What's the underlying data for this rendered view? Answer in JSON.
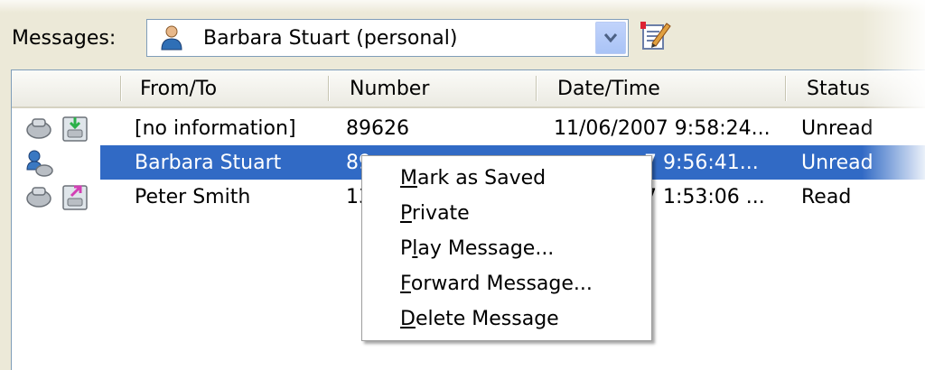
{
  "toolbar": {
    "label": "Messages:",
    "selected_mailbox": "Barbara Stuart (personal)",
    "icons": [
      "person-icon",
      "dropdown-arrow-icon",
      "edit-properties-icon"
    ]
  },
  "table": {
    "columns": [
      "From/To",
      "Number",
      "Date/Time",
      "Status"
    ],
    "rows": [
      {
        "icons": [
          "phone-icon",
          "incoming-message-icon"
        ],
        "from": "[no information]",
        "number": "89626",
        "datetime": "11/06/2007 9:58:24...",
        "status": "Unread",
        "selected": false
      },
      {
        "icons": [
          "user-phone-icon"
        ],
        "from": "Barbara Stuart",
        "number": "89",
        "datetime": "7 9:56:41...",
        "status": "Unread",
        "selected": true
      },
      {
        "icons": [
          "phone-icon",
          "outgoing-message-icon"
        ],
        "from": "Peter Smith",
        "number": "13",
        "datetime": "7 1:53:06 ...",
        "status": "Read",
        "selected": false
      }
    ]
  },
  "context_menu": {
    "items": [
      {
        "pre": "",
        "key": "M",
        "post": "ark as Saved"
      },
      {
        "pre": "",
        "key": "P",
        "post": "rivate"
      },
      {
        "pre": "P",
        "key": "l",
        "post": "ay Message..."
      },
      {
        "pre": "",
        "key": "F",
        "post": "orward Message..."
      },
      {
        "pre": "",
        "key": "D",
        "post": "elete Message"
      }
    ]
  },
  "colors": {
    "selection": "#316ac5",
    "window_bg": "#ece9d8",
    "header_bg": "#ebeae2"
  }
}
